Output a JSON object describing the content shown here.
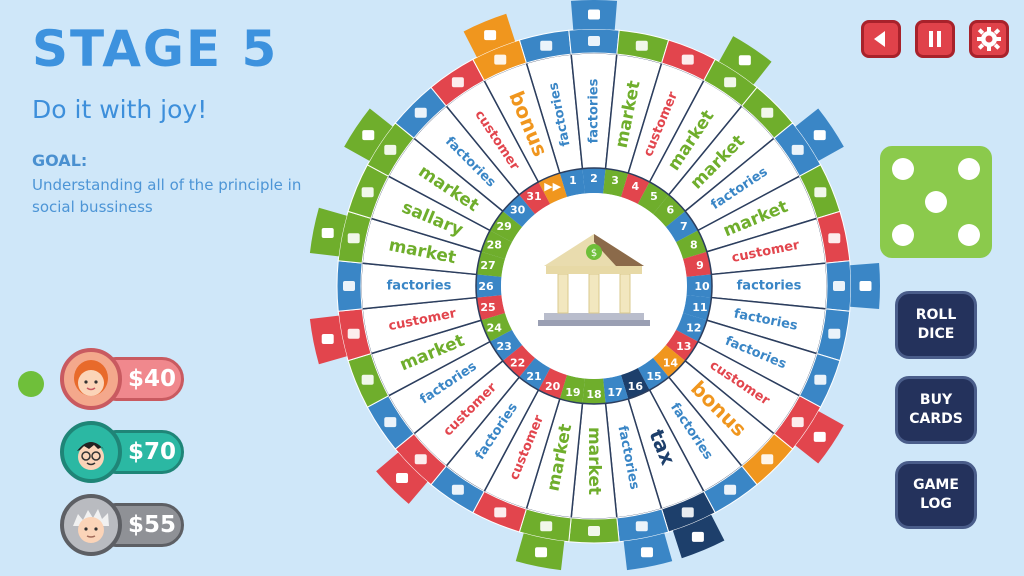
{
  "stage": {
    "title": "STAGE 5",
    "subtitle": "Do it with joy!"
  },
  "goal": {
    "label": "GOAL:",
    "text": "Understanding all of the principle in social bussiness"
  },
  "players": [
    {
      "name": "player-red-hair",
      "money": "$40",
      "pill_color": "#f0888d",
      "pill_border": "#c95a60",
      "avatar_bg": "#f4a88c",
      "active": true
    },
    {
      "name": "player-glasses",
      "money": "$70",
      "pill_color": "#2bb8a3",
      "pill_border": "#1f8577",
      "avatar_bg": "#2bb8a3",
      "active": false
    },
    {
      "name": "player-grandpa",
      "money": "$55",
      "pill_color": "#8f9196",
      "pill_border": "#5d5f64",
      "avatar_bg": "#b9bbc0",
      "active": false
    }
  ],
  "controls": {
    "back_icon": "back-icon",
    "pause_icon": "pause-icon",
    "settings_icon": "gear-icon"
  },
  "dice": {
    "value": 5
  },
  "buttons": {
    "roll": "ROLL\nDICE",
    "buy": "BUY\nCARDS",
    "log": "GAME\nLOG"
  },
  "colors": {
    "market": "#6fae2c",
    "factories": "#3a86c6",
    "customer": "#e2454d",
    "bonus": "#f0961e",
    "tax": "#1d3f6b",
    "sallary": "#6fae2c"
  },
  "board": {
    "center_icon": "bank-icon",
    "spaces": [
      {
        "n": "1",
        "label": "factories",
        "type": "factories"
      },
      {
        "n": "2",
        "label": "factories",
        "type": "factories"
      },
      {
        "n": "3",
        "label": "market",
        "type": "market"
      },
      {
        "n": "4",
        "label": "customer",
        "type": "customer"
      },
      {
        "n": "5",
        "label": "market",
        "type": "market"
      },
      {
        "n": "6",
        "label": "market",
        "type": "market"
      },
      {
        "n": "7",
        "label": "factories",
        "type": "factories"
      },
      {
        "n": "8",
        "label": "market",
        "type": "market"
      },
      {
        "n": "9",
        "label": "customer",
        "type": "customer"
      },
      {
        "n": "10",
        "label": "factories",
        "type": "factories"
      },
      {
        "n": "11",
        "label": "factories",
        "type": "factories"
      },
      {
        "n": "12",
        "label": "factories",
        "type": "factories"
      },
      {
        "n": "13",
        "label": "customer",
        "type": "customer"
      },
      {
        "n": "14",
        "label": "bonus",
        "type": "bonus"
      },
      {
        "n": "15",
        "label": "factories",
        "type": "factories"
      },
      {
        "n": "16",
        "label": "tax",
        "type": "tax"
      },
      {
        "n": "17",
        "label": "factories",
        "type": "factories"
      },
      {
        "n": "18",
        "label": "market",
        "type": "market"
      },
      {
        "n": "19",
        "label": "market",
        "type": "market"
      },
      {
        "n": "20",
        "label": "customer",
        "type": "customer"
      },
      {
        "n": "21",
        "label": "factories",
        "type": "factories"
      },
      {
        "n": "22",
        "label": "customer",
        "type": "customer"
      },
      {
        "n": "23",
        "label": "factories",
        "type": "factories"
      },
      {
        "n": "24",
        "label": "market",
        "type": "market"
      },
      {
        "n": "25",
        "label": "customer",
        "type": "customer"
      },
      {
        "n": "26",
        "label": "factories",
        "type": "factories"
      },
      {
        "n": "27",
        "label": "market",
        "type": "market"
      },
      {
        "n": "28",
        "label": "sallary",
        "type": "sallary"
      },
      {
        "n": "29",
        "label": "market",
        "type": "market"
      },
      {
        "n": "30",
        "label": "factories",
        "type": "factories"
      },
      {
        "n": "31",
        "label": "customer",
        "type": "customer"
      },
      {
        "n": "",
        "label": "bonus",
        "type": "bonus"
      }
    ]
  }
}
